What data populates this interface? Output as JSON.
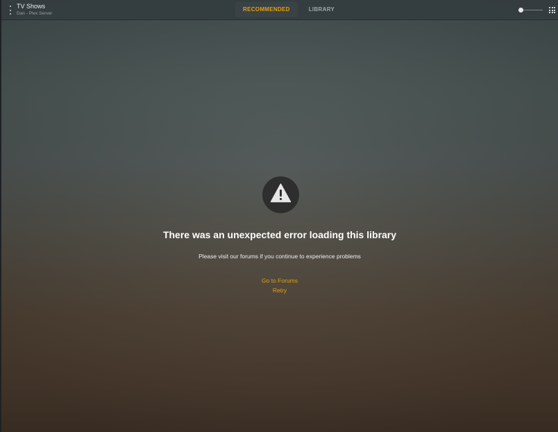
{
  "header": {
    "title": "TV Shows",
    "subtitle": "Dan - Plex Server",
    "tabs": [
      {
        "label": "RECOMMENDED",
        "active": true
      },
      {
        "label": "LIBRARY",
        "active": false
      }
    ],
    "icons": {
      "menu": "more-vertical-icon",
      "view": "grid-view-icon"
    },
    "poster_size_level": 0
  },
  "error": {
    "icon": "warning-icon",
    "title": "There was an unexpected error loading this library",
    "message": "Please visit our forums if you continue to experience problems",
    "forums_link": "Go to Forums",
    "retry_link": "Retry"
  },
  "colors": {
    "accent": "#e5a00d",
    "topbar": "#343c3f"
  }
}
